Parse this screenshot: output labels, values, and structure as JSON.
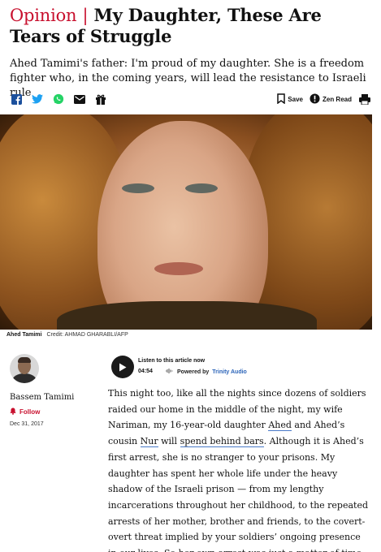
{
  "article": {
    "section": "Opinion",
    "separator": "|",
    "title": "My Daughter, These Are Tears of Struggle",
    "subtitle": "Ahed Tamimi's father: I'm proud of my daughter. She is a freedom fighter who, in the coming years, will lead the resistance to Israeli rule"
  },
  "share": {
    "icons": [
      "facebook-icon",
      "twitter-icon",
      "whatsapp-icon",
      "email-icon",
      "gift-icon"
    ],
    "save_label": "Save",
    "zen_label": "Zen Read",
    "accent_color": "#1877f2"
  },
  "image": {
    "caption_name": "Ahed Tamimi",
    "caption_credit": "Credit: AHMAD GHARABLI/AFP"
  },
  "author": {
    "name": "Bassem Tamimi",
    "follow_label": "Follow",
    "date": "Dec 31, 2017"
  },
  "audio": {
    "title": "Listen to this article now",
    "duration": "04:54",
    "powered_prefix": "Powered by",
    "powered_brand": "Trinity Audio"
  },
  "body": {
    "p1_a": "This night too, like all the nights since dozens of soldiers raided our home in the middle of the night, my wife Nariman, my 16-year-old daughter ",
    "link_ahed": "Ahed",
    "p1_b": " and Ahed’s cousin ",
    "link_nur": "Nur",
    "p1_c": " will ",
    "link_bars": "spend behind bars",
    "p1_d": ". Although it is Ahed’s first arrest, she is no stranger to your prisons. My daughter has spent her whole life under the heavy shadow of the Israeli prison — from my lengthy incarcerations throughout her childhood, to the repeated arrests of her mother, brother and friends, to the covert-overt threat implied by your soldiers’ ongoing presence in our lives. So her own arrest was just a matter of time. An inevitable tragedy waiting to happen."
  },
  "colors": {
    "brand_red": "#c8102e",
    "text": "#111111",
    "link_underline": "#4a7ac8"
  }
}
